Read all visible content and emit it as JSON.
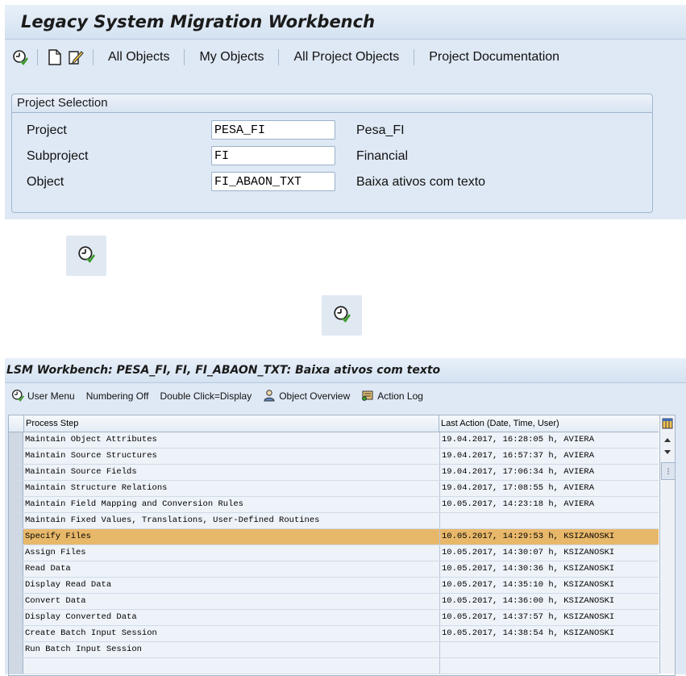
{
  "top": {
    "title": "Legacy System Migration Workbench",
    "toolbar": {
      "links": [
        "All Objects",
        "My Objects",
        "All Project Objects",
        "Project Documentation"
      ]
    },
    "group_title": "Project Selection",
    "fields": [
      {
        "label": "Project",
        "value": "PESA_FI",
        "desc": "Pesa_FI"
      },
      {
        "label": "Subproject",
        "value": "FI",
        "desc": "Financial"
      },
      {
        "label": "Object",
        "value": "FI_ABAON_TXT",
        "desc": "Baixa ativos com texto"
      }
    ]
  },
  "bottom": {
    "title": "LSM Workbench: PESA_FI, FI, FI_ABAON_TXT: Baixa ativos com texto",
    "toolbar": {
      "user_menu": "User Menu",
      "numbering": "Numbering Off",
      "double_click": "Double Click=Display",
      "object_overview": "Object Overview",
      "action_log": "Action Log"
    },
    "table": {
      "headers": [
        "Process Step",
        "Last Action (Date, Time, User)"
      ],
      "rows": [
        {
          "step": "Maintain Object Attributes",
          "action": "19.04.2017, 16:28:05 h, AVIERA"
        },
        {
          "step": "Maintain Source Structures",
          "action": "19.04.2017, 16:57:37 h, AVIERA"
        },
        {
          "step": "Maintain Source Fields",
          "action": "19.04.2017, 17:06:34 h, AVIERA"
        },
        {
          "step": "Maintain Structure Relations",
          "action": "19.04.2017, 17:08:55 h, AVIERA"
        },
        {
          "step": "Maintain Field Mapping and Conversion Rules",
          "action": "10.05.2017, 14:23:18 h, AVIERA"
        },
        {
          "step": "Maintain Fixed Values, Translations, User-Defined Routines",
          "action": ""
        },
        {
          "step": "Specify Files",
          "action": "10.05.2017, 14:29:53 h, KSIZANOSKI"
        },
        {
          "step": "Assign Files",
          "action": "10.05.2017, 14:30:07 h, KSIZANOSKI"
        },
        {
          "step": "Read Data",
          "action": "10.05.2017, 14:30:36 h, KSIZANOSKI"
        },
        {
          "step": "Display Read Data",
          "action": "10.05.2017, 14:35:10 h, KSIZANOSKI"
        },
        {
          "step": "Convert Data",
          "action": "10.05.2017, 14:36:00 h, KSIZANOSKI"
        },
        {
          "step": "Display Converted Data",
          "action": "10.05.2017, 14:37:57 h, KSIZANOSKI"
        },
        {
          "step": "Create Batch Input Session",
          "action": "10.05.2017, 14:38:54 h, KSIZANOSKI"
        },
        {
          "step": "Run Batch Input Session",
          "action": ""
        },
        {
          "step": "",
          "action": ""
        }
      ]
    }
  }
}
